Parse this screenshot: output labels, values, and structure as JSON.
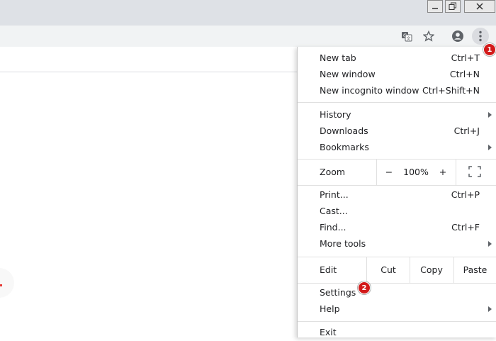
{
  "menu": {
    "new_tab": {
      "label": "New tab",
      "shortcut": "Ctrl+T"
    },
    "new_window": {
      "label": "New window",
      "shortcut": "Ctrl+N"
    },
    "new_incognito": {
      "label": "New incognito window",
      "shortcut": "Ctrl+Shift+N"
    },
    "history": {
      "label": "History"
    },
    "downloads": {
      "label": "Downloads",
      "shortcut": "Ctrl+J"
    },
    "bookmarks": {
      "label": "Bookmarks"
    },
    "zoom": {
      "label": "Zoom",
      "minus": "−",
      "value": "100%",
      "plus": "+"
    },
    "print": {
      "label": "Print...",
      "shortcut": "Ctrl+P"
    },
    "cast": {
      "label": "Cast..."
    },
    "find": {
      "label": "Find...",
      "shortcut": "Ctrl+F"
    },
    "more_tools": {
      "label": "More tools"
    },
    "edit": {
      "label": "Edit",
      "cut": "Cut",
      "copy": "Copy",
      "paste": "Paste"
    },
    "settings": {
      "label": "Settings"
    },
    "help": {
      "label": "Help"
    },
    "exit": {
      "label": "Exit"
    }
  },
  "badges": {
    "first": "1",
    "second": "2"
  },
  "icons": {
    "translate": "translate-icon",
    "star": "bookmark-star-icon",
    "account": "account-icon",
    "menu": "kebab-menu-icon",
    "fullscreen": "fullscreen-icon"
  },
  "colors": {
    "badge": "#d21a1a",
    "toolbar": "#f1f3f4",
    "titlebar": "#dee1e6"
  }
}
